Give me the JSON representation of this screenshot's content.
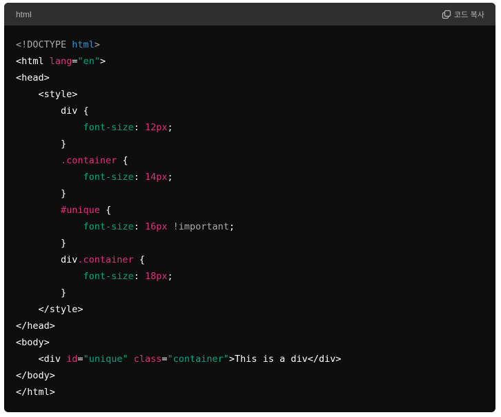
{
  "header": {
    "language": "html",
    "copy_label": "코드 복사"
  },
  "colors": {
    "background": "#0d0d0d",
    "header_background": "#2f2f2f",
    "tag": "#ffffff",
    "attribute": "#df3079",
    "string": "#00a67d",
    "doctype_keyword": "#2e95d3",
    "css_property": "#00a67d",
    "css_number": "#df3079",
    "muted": "#aaaaaa"
  },
  "code_lines": [
    [
      {
        "t": "<!DOCTYPE ",
        "c": "muted"
      },
      {
        "t": "html",
        "c": "blue"
      },
      {
        "t": ">",
        "c": "muted"
      }
    ],
    [
      {
        "t": "<html ",
        "c": "plain"
      },
      {
        "t": "lang",
        "c": "pink"
      },
      {
        "t": "=",
        "c": "plain"
      },
      {
        "t": "\"en\"",
        "c": "green"
      },
      {
        "t": ">",
        "c": "plain"
      }
    ],
    [
      {
        "t": "<head>",
        "c": "plain"
      }
    ],
    [
      {
        "t": "    <style>",
        "c": "plain"
      }
    ],
    [
      {
        "t": "        div {",
        "c": "plain"
      }
    ],
    [
      {
        "t": "            ",
        "c": "plain"
      },
      {
        "t": "font-size",
        "c": "green"
      },
      {
        "t": ": ",
        "c": "plain"
      },
      {
        "t": "12px",
        "c": "pink"
      },
      {
        "t": ";",
        "c": "plain"
      }
    ],
    [
      {
        "t": "        }",
        "c": "plain"
      }
    ],
    [
      {
        "t": "        ",
        "c": "plain"
      },
      {
        "t": ".container",
        "c": "pink"
      },
      {
        "t": " {",
        "c": "plain"
      }
    ],
    [
      {
        "t": "            ",
        "c": "plain"
      },
      {
        "t": "font-size",
        "c": "green"
      },
      {
        "t": ": ",
        "c": "plain"
      },
      {
        "t": "14px",
        "c": "pink"
      },
      {
        "t": ";",
        "c": "plain"
      }
    ],
    [
      {
        "t": "        }",
        "c": "plain"
      }
    ],
    [
      {
        "t": "        ",
        "c": "plain"
      },
      {
        "t": "#unique",
        "c": "pink"
      },
      {
        "t": " {",
        "c": "plain"
      }
    ],
    [
      {
        "t": "            ",
        "c": "plain"
      },
      {
        "t": "font-size",
        "c": "green"
      },
      {
        "t": ": ",
        "c": "plain"
      },
      {
        "t": "16px",
        "c": "pink"
      },
      {
        "t": " !important",
        "c": "muted"
      },
      {
        "t": ";",
        "c": "plain"
      }
    ],
    [
      {
        "t": "        }",
        "c": "plain"
      }
    ],
    [
      {
        "t": "        div",
        "c": "plain"
      },
      {
        "t": ".container",
        "c": "pink"
      },
      {
        "t": " {",
        "c": "plain"
      }
    ],
    [
      {
        "t": "            ",
        "c": "plain"
      },
      {
        "t": "font-size",
        "c": "green"
      },
      {
        "t": ": ",
        "c": "plain"
      },
      {
        "t": "18px",
        "c": "pink"
      },
      {
        "t": ";",
        "c": "plain"
      }
    ],
    [
      {
        "t": "        }",
        "c": "plain"
      }
    ],
    [
      {
        "t": "    </style>",
        "c": "plain"
      }
    ],
    [
      {
        "t": "</head>",
        "c": "plain"
      }
    ],
    [
      {
        "t": "<body>",
        "c": "plain"
      }
    ],
    [
      {
        "t": "    <div ",
        "c": "plain"
      },
      {
        "t": "id",
        "c": "pink"
      },
      {
        "t": "=",
        "c": "plain"
      },
      {
        "t": "\"unique\"",
        "c": "green"
      },
      {
        "t": " ",
        "c": "plain"
      },
      {
        "t": "class",
        "c": "pink"
      },
      {
        "t": "=",
        "c": "plain"
      },
      {
        "t": "\"container\"",
        "c": "green"
      },
      {
        "t": ">This is a div</div>",
        "c": "plain"
      }
    ],
    [
      {
        "t": "</body>",
        "c": "plain"
      }
    ],
    [
      {
        "t": "</html>",
        "c": "plain"
      }
    ]
  ]
}
